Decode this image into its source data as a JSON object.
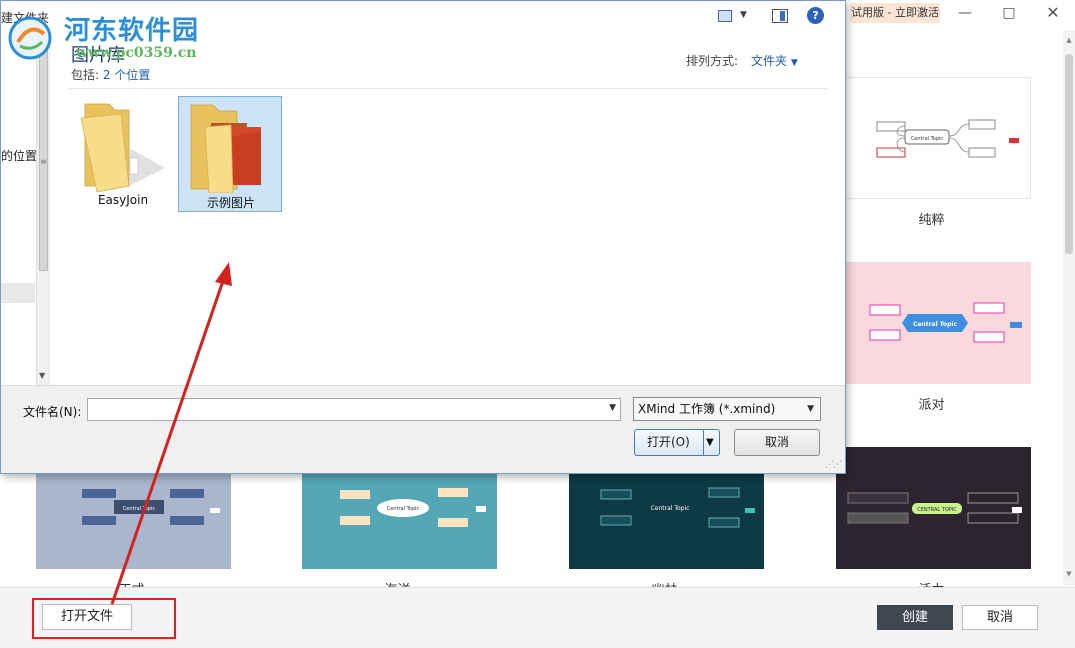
{
  "dialog": {
    "partial_title": "建文件夹",
    "library_title": "图片库",
    "includes_label": "包括:",
    "includes_link": "2 个位置",
    "arrange_label": "排列方式:",
    "arrange_value": "文件夹",
    "nav_partial_text": "的位置",
    "folders": [
      {
        "label": "EasyJoin",
        "selected": false
      },
      {
        "label": "示例图片",
        "selected": true
      }
    ],
    "filename_label": "文件名(N):",
    "filename_value": "",
    "filetype_value": "XMind 工作簿 (*.xmind)",
    "open_button": "打开(O)",
    "cancel_button": "取消",
    "help_glyph": "?"
  },
  "xmind": {
    "trial_badge": "试用版 - 立即激活",
    "window_controls": {
      "minimize": "—",
      "maximize": "□",
      "close": "✕"
    },
    "themes": [
      {
        "label": "纯粹",
        "bg": "#ffffff",
        "central": "Central Topic"
      },
      {
        "label": "派对",
        "bg": "#f9d9de",
        "central": "Central Topic"
      },
      {
        "label": "正式",
        "bg": "#a9b6cd",
        "central": "Central Topic"
      },
      {
        "label": "海洋",
        "bg": "#54a7b5",
        "central": "Central Topic"
      },
      {
        "label": "幽林",
        "bg": "#0d3a44",
        "central": "Central Topic"
      },
      {
        "label": "活力",
        "bg": "#2c2530",
        "central": "CENTRAL TOPIC"
      }
    ],
    "open_file_button": "打开文件",
    "create_button": "创建",
    "cancel_button": "取消"
  },
  "watermark": {
    "title": "河东软件园",
    "url": "www.pc0359.cn"
  },
  "colors": {
    "accent_blue": "#1f5fb5",
    "annotation_red": "#e0221f",
    "create_button_bg": "#3f4850"
  }
}
